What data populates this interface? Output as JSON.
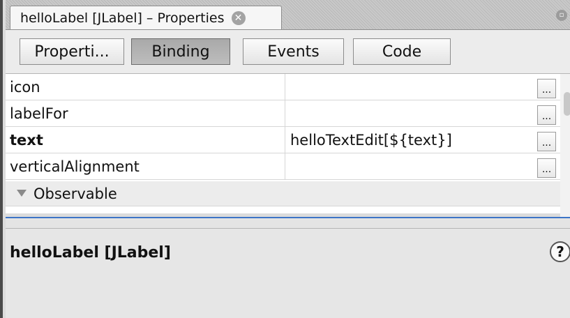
{
  "window": {
    "tab_title": "helloLabel [JLabel] – Properties",
    "close_glyph": "✕",
    "maximize_glyph": "▫"
  },
  "toolbar": {
    "buttons": [
      {
        "label": "Properti..."
      },
      {
        "label": "Binding"
      },
      {
        "label": "Events"
      },
      {
        "label": "Code"
      }
    ]
  },
  "properties": {
    "rows": [
      {
        "name": "icon",
        "value": "",
        "button": "..."
      },
      {
        "name": "labelFor",
        "value": "",
        "button": "..."
      },
      {
        "name": "text",
        "value": "helloTextEdit[${text}]",
        "button": "..."
      },
      {
        "name": "verticalAlignment",
        "value": "",
        "button": "..."
      }
    ],
    "category": "Observable"
  },
  "description": {
    "title": "helloLabel [JLabel]",
    "help_glyph": "?"
  }
}
